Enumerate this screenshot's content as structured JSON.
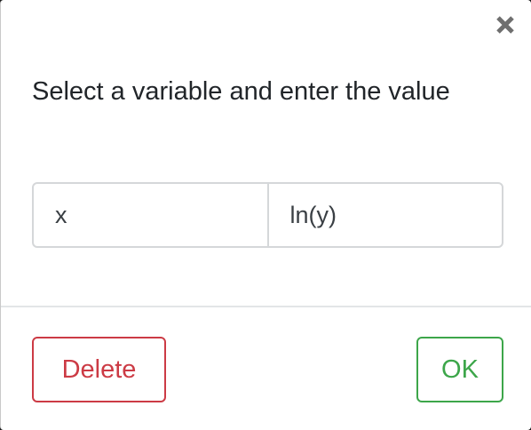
{
  "dialog": {
    "prompt": "Select a variable and enter the value",
    "close_icon": "close-icon",
    "variables": [
      {
        "label": "x"
      },
      {
        "label": "ln(y)"
      }
    ],
    "buttons": {
      "delete_label": "Delete",
      "ok_label": "OK"
    }
  },
  "colors": {
    "delete": "#cc3b45",
    "ok": "#3da64a",
    "text": "#212529",
    "border": "#d5d7d9"
  }
}
